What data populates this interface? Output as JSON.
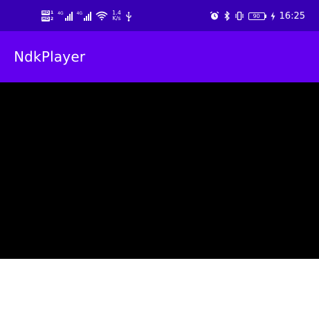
{
  "colors": {
    "status_bar": "#3700b3",
    "app_bar": "#6200ee",
    "video_background": "#000000",
    "page_background": "#ffffff",
    "foreground": "#ffffff"
  },
  "status_bar": {
    "sim1_badge": "HD",
    "sim1_number": "1",
    "sim2_badge": "HD",
    "sim2_number": "2",
    "sim1_network": "4G",
    "sim2_network": "4G",
    "speed_value": "1.4",
    "speed_unit": "K/s",
    "battery_level": "90",
    "time": "16:25",
    "icons": [
      "signal-icon",
      "wifi-icon",
      "usb-icon",
      "alarm-icon",
      "bluetooth-icon",
      "vibrate-icon",
      "battery-icon",
      "charging-icon"
    ]
  },
  "app_bar": {
    "title": "NdkPlayer"
  }
}
